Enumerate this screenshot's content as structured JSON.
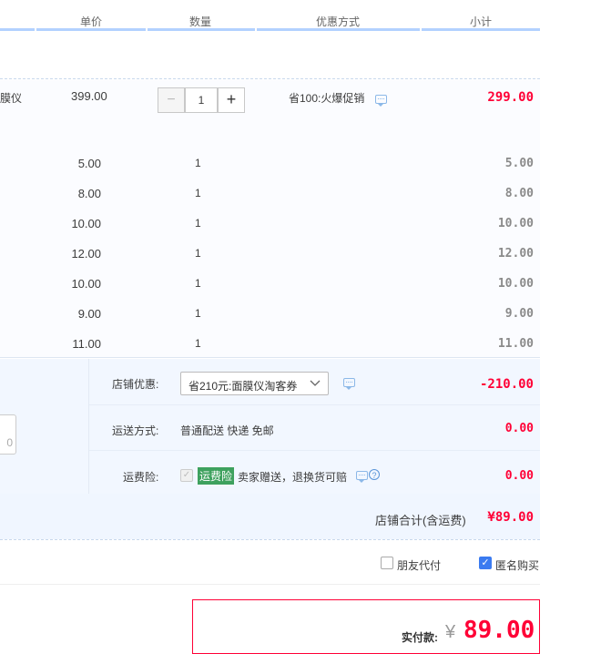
{
  "header": {
    "price": "单价",
    "qty": "数量",
    "discount": "优惠方式",
    "subtotal": "小计"
  },
  "main_item": {
    "name_tail": "膜仪",
    "price": "399.00",
    "qty": "1",
    "discount": "省100:火爆促销",
    "subtotal": "299.00"
  },
  "sub_items": [
    {
      "price": "5.00",
      "qty": "1",
      "subtotal": "5.00"
    },
    {
      "price": "8.00",
      "qty": "1",
      "subtotal": "8.00"
    },
    {
      "price": "10.00",
      "qty": "1",
      "subtotal": "10.00"
    },
    {
      "price": "12.00",
      "qty": "1",
      "subtotal": "12.00"
    },
    {
      "price": "10.00",
      "qty": "1",
      "subtotal": "10.00"
    },
    {
      "price": "9.00",
      "qty": "1",
      "subtotal": "9.00"
    },
    {
      "price": "11.00",
      "qty": "1",
      "subtotal": "11.00"
    }
  ],
  "stepper": {
    "minus": "−",
    "plus": "+"
  },
  "shop": {
    "coupon_label": "店铺优惠:",
    "coupon_value": "省210元:面膜仪淘客券",
    "coupon_amount": "-210.00",
    "shipping_label": "运送方式:",
    "shipping_value": "普通配送 快递 免邮",
    "shipping_amount": "0.00",
    "insurance_label": "运费险:",
    "insurance_tag": "运费险",
    "insurance_text": "卖家赠送，退换货可赔",
    "insurance_amount": "0.00",
    "left_input_tail": "0",
    "total_label": "店铺合计(含运费)",
    "total_amount": "¥89.00"
  },
  "options": {
    "friend_pay": "朋友代付",
    "anonymous": "匿名购买"
  },
  "payment": {
    "label": "实付款:",
    "currency": "¥",
    "amount": "89.00"
  },
  "colors": {
    "accent_red": "#ff0036",
    "header_line": "#b2d1ff",
    "panel_bg": "#f2f7ff",
    "checkbox_blue": "#3b7bf0",
    "insurance_tag_bg": "#3ea15e"
  }
}
